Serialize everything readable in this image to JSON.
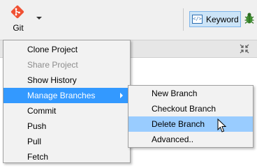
{
  "toolbar": {
    "git_label": "Git",
    "keyword_label": "Keyword",
    "keyword_icon_glyph": "</>"
  },
  "main_menu": {
    "items": [
      {
        "label": "Clone Project",
        "enabled": true
      },
      {
        "label": "Share Project",
        "enabled": false
      },
      {
        "label": "Show History",
        "enabled": true
      },
      {
        "label": "Manage Branches",
        "enabled": true,
        "has_submenu": true,
        "active": true
      },
      {
        "label": "Commit",
        "enabled": true
      },
      {
        "label": "Push",
        "enabled": true
      },
      {
        "label": "Pull",
        "enabled": true
      },
      {
        "label": "Fetch",
        "enabled": true
      }
    ]
  },
  "sub_menu": {
    "items": [
      {
        "label": "New Branch"
      },
      {
        "label": "Checkout Branch"
      },
      {
        "label": "Delete Branch",
        "hovered": true
      },
      {
        "label": "Advanced.."
      }
    ]
  },
  "colors": {
    "git_brand": "#f05133",
    "menu_active": "#3399ff",
    "menu_hover": "#99ccff",
    "keyword_toggle_bg": "#cce4f7"
  }
}
